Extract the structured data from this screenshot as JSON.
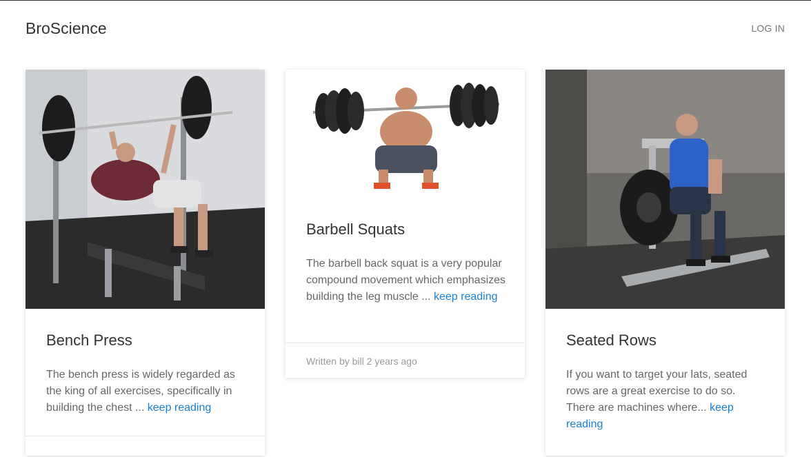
{
  "header": {
    "brand": "BroScience",
    "login": "LOG IN"
  },
  "cards": [
    {
      "title": "Bench Press",
      "excerpt": "The bench press is widely regarded as the king of all exercises, specifically in building the chest ... ",
      "link": "keep reading",
      "image_icon": "bench-press-photo"
    },
    {
      "title": "Barbell Squats",
      "excerpt": "The barbell back squat is a very popular compound movement which emphasizes building the leg muscle ... ",
      "link": "keep reading",
      "byline": "Written by bill 2 years ago",
      "image_icon": "barbell-squat-photo"
    },
    {
      "title": "Seated Rows",
      "excerpt": "If you want to target your lats, seated rows are a great exercise to do so. There are machines where... ",
      "link": "keep reading",
      "image_icon": "seated-row-photo"
    }
  ],
  "colors": {
    "link": "#1a7fd6",
    "title": "#333333",
    "text": "#666666"
  }
}
